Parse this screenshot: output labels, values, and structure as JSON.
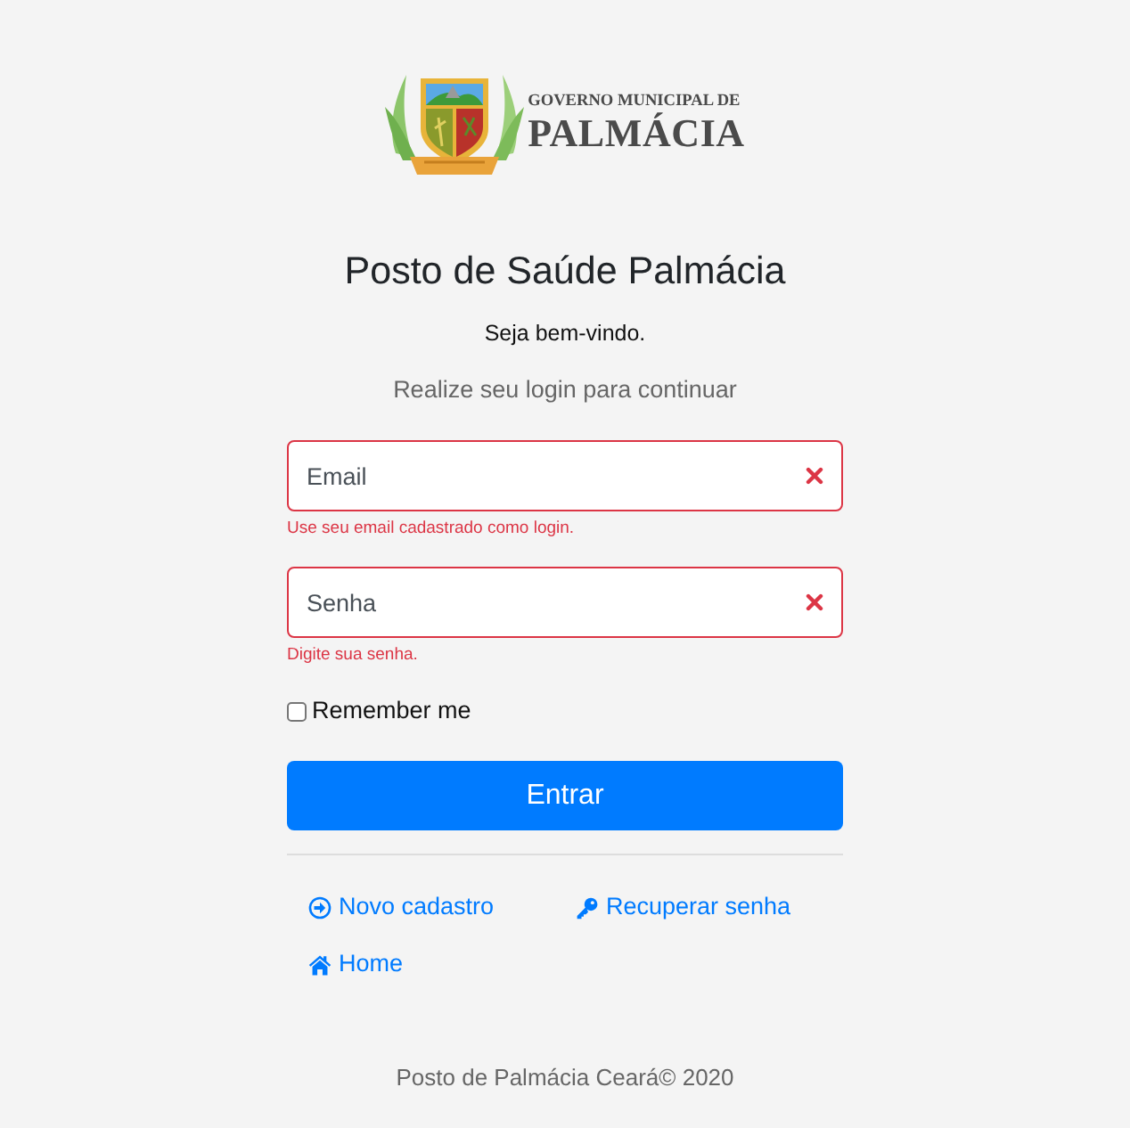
{
  "logo": {
    "line_1": "GOVERNO MUNICIPAL DE",
    "line_2": "PALMÁCIA"
  },
  "title": "Posto de Saúde Palmácia",
  "welcome": "Seja bem-vindo.",
  "subtitle": "Realize seu login para continuar",
  "fields": [
    {
      "placeholder": "Email",
      "invalid": true,
      "error": "Use seu email cadastrado como login."
    },
    {
      "placeholder": "Senha",
      "invalid": true,
      "error": "Digite sua senha."
    }
  ],
  "remember": {
    "label": "Remember me",
    "checked": false
  },
  "submit": "Entrar",
  "links": [
    {
      "label": "Novo cadastro",
      "kind": "sign-in"
    },
    {
      "label": "Recuperar senha",
      "kind": "key"
    },
    {
      "label": "Home",
      "kind": "home"
    }
  ],
  "footer": "Posto de Palmácia Ceará© 2020"
}
